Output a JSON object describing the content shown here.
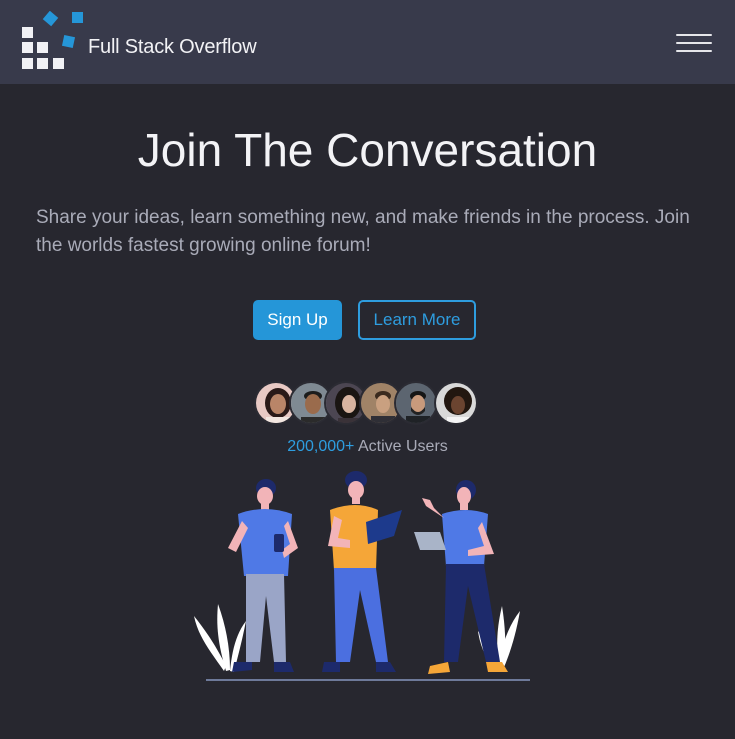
{
  "navbar": {
    "brand": "Full Stack Overflow",
    "logo_icon": "grid-squares-logo",
    "menu_icon": "hamburger-icon"
  },
  "hero": {
    "title": "Join The Conversation",
    "subtitle": "Share your ideas, learn something new, and make friends in the process. Join the worlds fastest growing online forum!",
    "buttons": {
      "primary_label": "Sign Up",
      "secondary_label": "Learn More"
    }
  },
  "community": {
    "user_count": "200,000+",
    "user_label": " Active Users",
    "avatars": [
      {
        "name": "avatar-1"
      },
      {
        "name": "avatar-2"
      },
      {
        "name": "avatar-3"
      },
      {
        "name": "avatar-4"
      },
      {
        "name": "avatar-5"
      },
      {
        "name": "avatar-6"
      }
    ]
  },
  "colors": {
    "background": "#27272f",
    "navbar": "#383a4b",
    "accent": "#2596d8",
    "text_muted": "#a9abb8"
  }
}
